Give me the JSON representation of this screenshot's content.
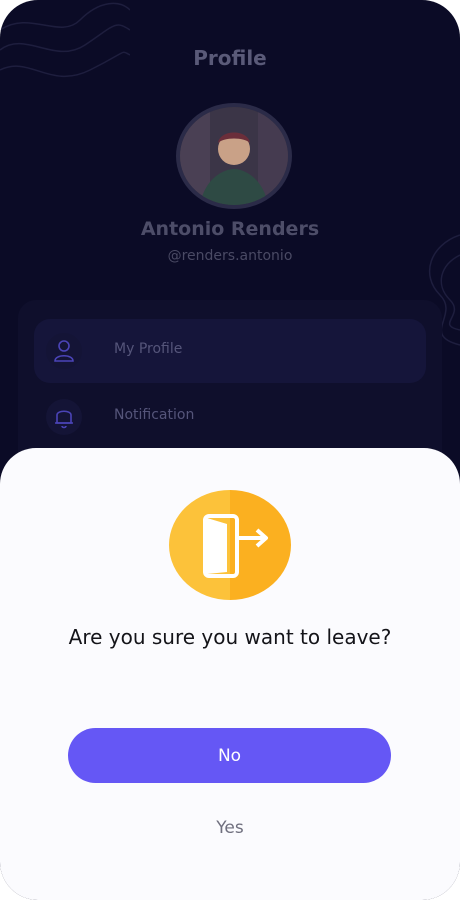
{
  "header": {
    "title": "Profile"
  },
  "profile": {
    "name": "Antonio Renders",
    "handle": "@renders.antonio"
  },
  "menu": {
    "items": [
      {
        "label": "My Profile",
        "icon": "user-icon"
      },
      {
        "label": "Notification",
        "icon": "bell-icon"
      }
    ]
  },
  "dialog": {
    "icon": "exit-door-icon",
    "question": "Are you sure you want to leave?",
    "no_label": "No",
    "yes_label": "Yes"
  },
  "colors": {
    "background": "#0b0b26",
    "accent": "#6557f5",
    "warning": "#fbb928",
    "sheet": "#fbfbfe"
  }
}
